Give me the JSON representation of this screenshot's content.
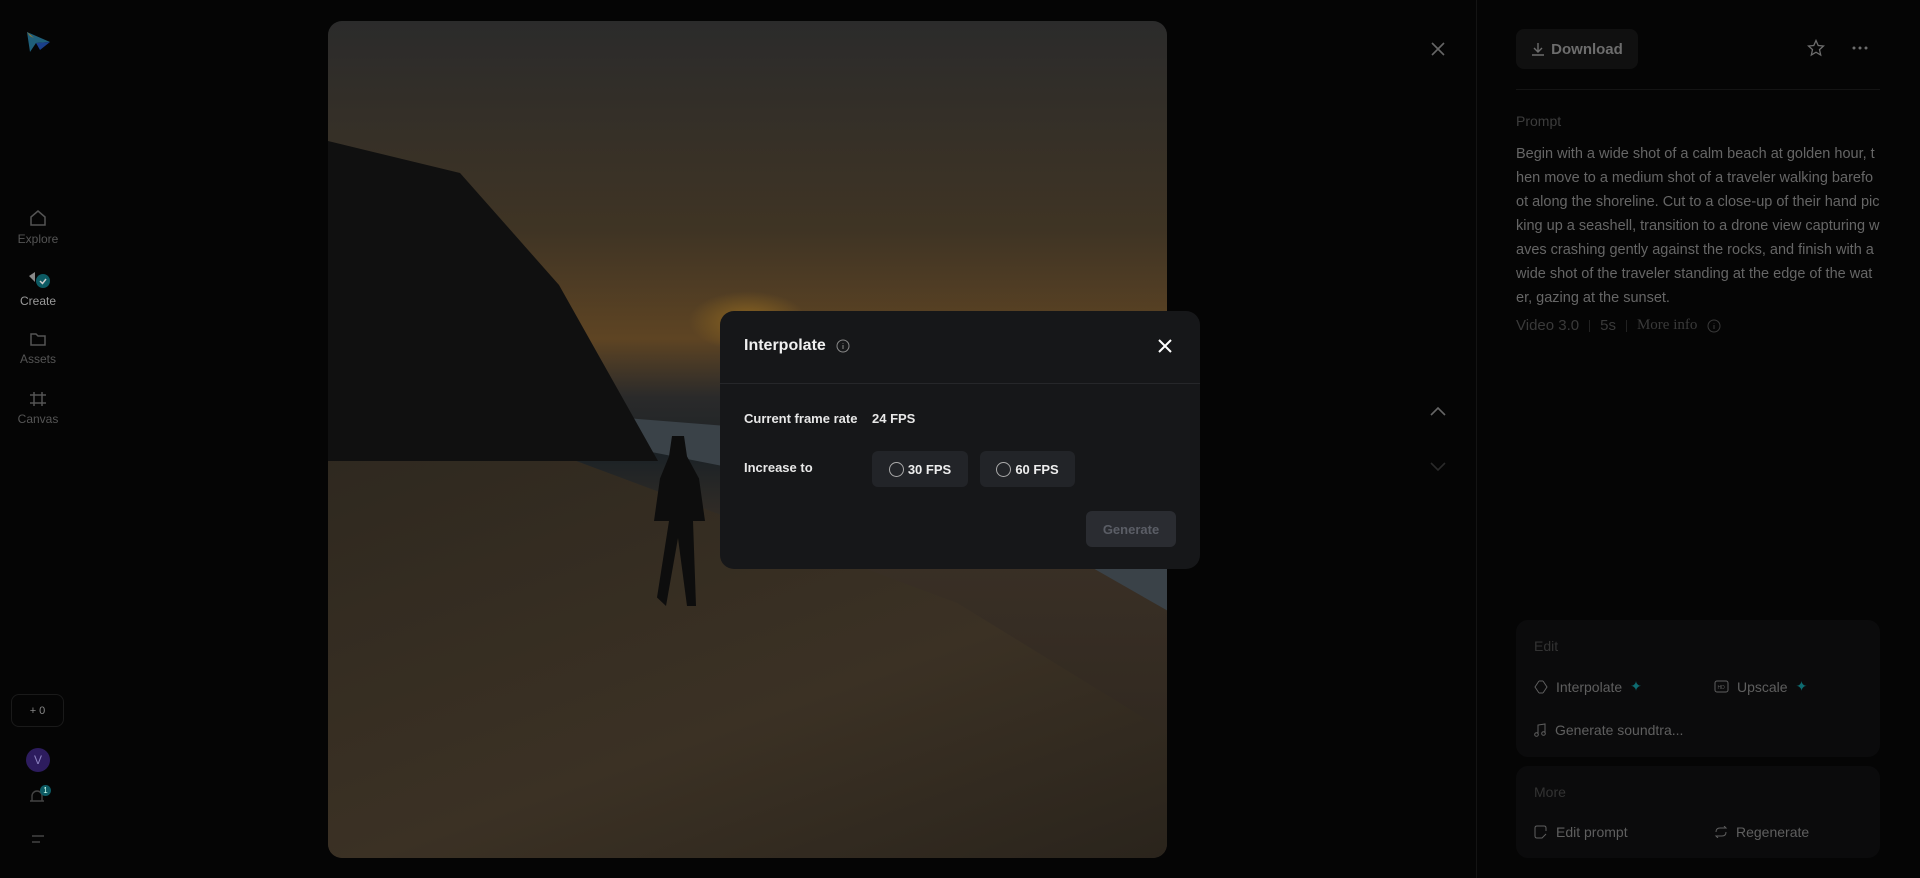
{
  "sidebar": {
    "items": [
      {
        "label": "Explore",
        "icon": "home-icon"
      },
      {
        "label": "Create",
        "icon": "create-icon",
        "active": true
      },
      {
        "label": "Assets",
        "icon": "folder-icon"
      },
      {
        "label": "Canvas",
        "icon": "canvas-icon"
      }
    ],
    "credits": "+ 0",
    "avatar": "V",
    "notifications": "1"
  },
  "toolbar": {
    "download": "Download"
  },
  "details": {
    "prompt_label": "Prompt",
    "prompt": "Begin with a wide shot of a calm beach at golden hour, then move to a medium shot of a traveler walking barefoot along the shoreline. Cut to a close-up of their hand picking up a seashell, transition to a drone view capturing waves crashing gently against the rocks, and finish with a wide shot of the traveler standing at the edge of the water, gazing at the sunset.",
    "model": "Video 3.0",
    "duration": "5s",
    "more_info": "More info"
  },
  "edit": {
    "title": "Edit",
    "interpolate": "Interpolate",
    "upscale": "Upscale",
    "soundtrack": "Generate soundtra..."
  },
  "more": {
    "title": "More",
    "edit_prompt": "Edit prompt",
    "regenerate": "Regenerate"
  },
  "modal": {
    "title": "Interpolate",
    "current_label": "Current frame rate",
    "current_value": "24 FPS",
    "increase_label": "Increase to",
    "options": [
      "30 FPS",
      "60 FPS"
    ],
    "generate": "Generate"
  },
  "colors": {
    "accent": "#0e6b70",
    "modal_bg": "#161719"
  }
}
